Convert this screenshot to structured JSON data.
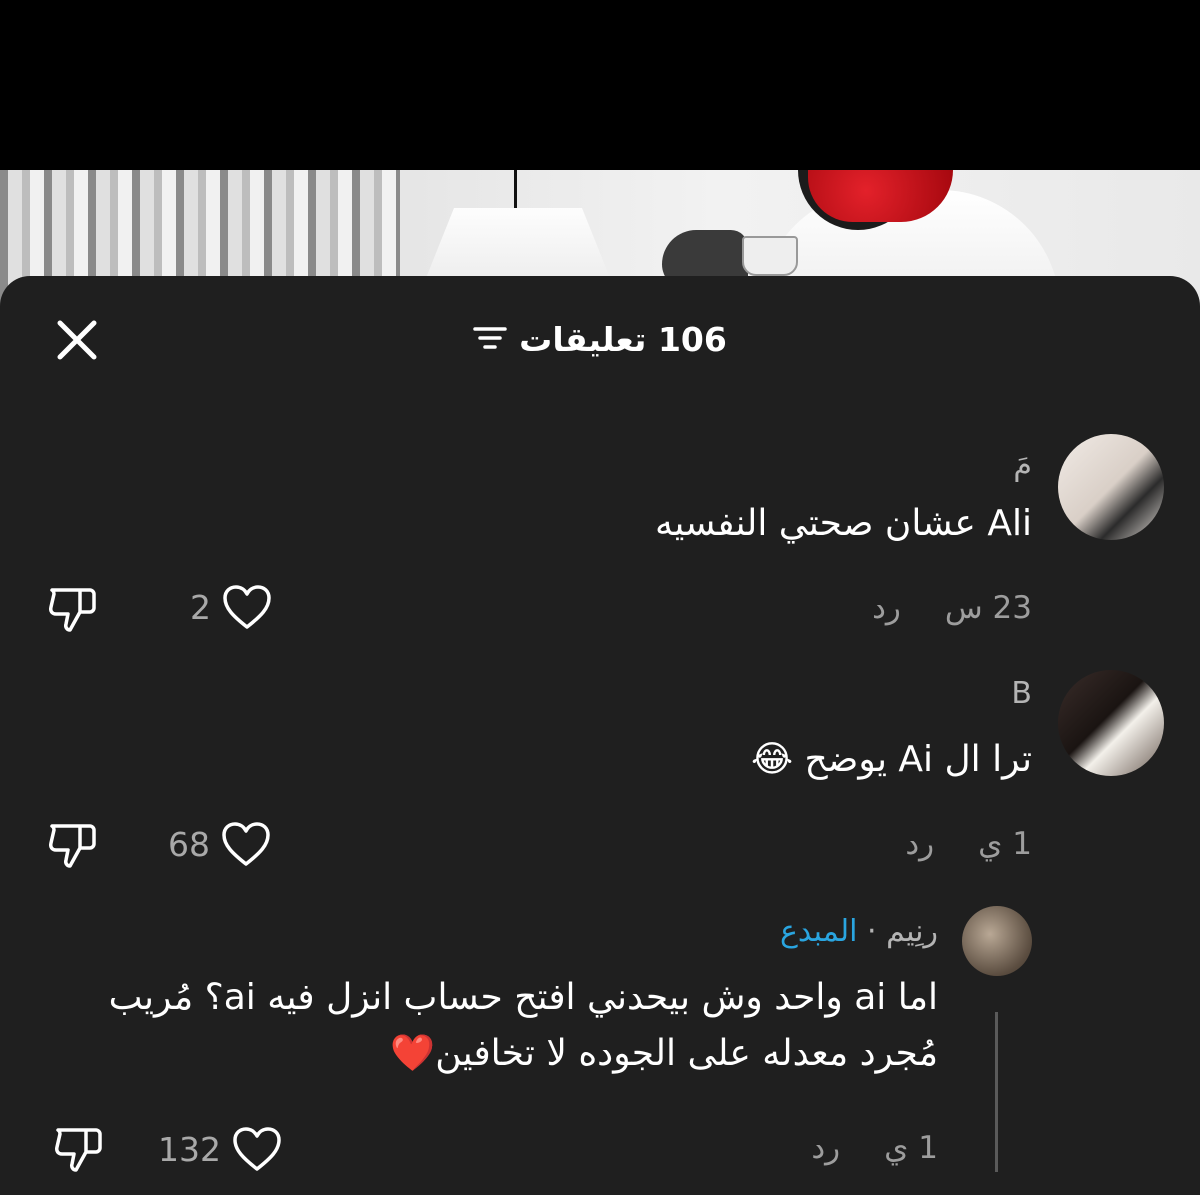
{
  "header": {
    "title": "106 تعليقات"
  },
  "comments": [
    {
      "username": "مَ",
      "text": "Ali عشان صحتي النفسيه",
      "time": "23 س",
      "reply_label": "رد",
      "likes": "2"
    },
    {
      "username": "B",
      "text": "ترا ال Ai يوضح 😂",
      "time": "1 ي",
      "reply_label": "رد",
      "likes": "68"
    },
    {
      "username": "رنِيم",
      "separator": "·",
      "badge": "المبدع",
      "text_line1": "اما ai واحد وش بيحدني افتح حساب انزل فيه ai؟ مُريب",
      "text_line2": "مُجرد معدله على الجوده لا تخافين❤️",
      "time": "1 ي",
      "reply_label": "رد",
      "likes": "132"
    }
  ],
  "colors": {
    "sheet_bg": "#1f1f1f",
    "text": "#ffffff",
    "muted": "#9d9d9d",
    "badge": "#2aa5e0"
  },
  "icons": [
    "close-icon",
    "filter-icon",
    "heart-icon",
    "dislike-icon"
  ]
}
